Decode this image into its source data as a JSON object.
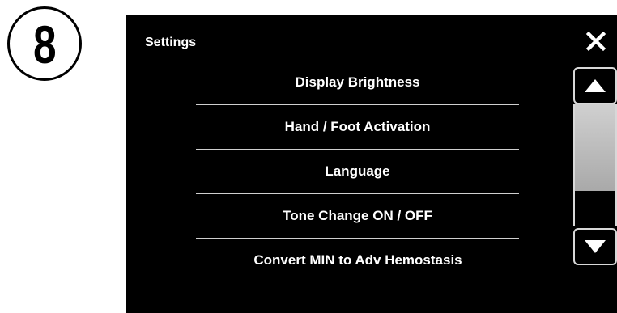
{
  "step_badge": {
    "number": "8"
  },
  "dialog": {
    "title": "Settings",
    "close_icon": "close-icon"
  },
  "menu": {
    "items": [
      {
        "label": "Display Brightness"
      },
      {
        "label": "Hand / Foot Activation"
      },
      {
        "label": "Language"
      },
      {
        "label": "Tone Change ON / OFF"
      },
      {
        "label": "Convert MIN to Adv Hemostasis"
      }
    ]
  },
  "scrollbar": {
    "up_icon": "triangle-up-icon",
    "down_icon": "triangle-down-icon",
    "thumb_fraction_of_track": 0.71,
    "thumb_position": 0.0
  },
  "colors": {
    "screen_background": "#000000",
    "text": "#ffffff",
    "divider": "#cfcfcf",
    "scroll_thumb": "#bdbdbd"
  }
}
